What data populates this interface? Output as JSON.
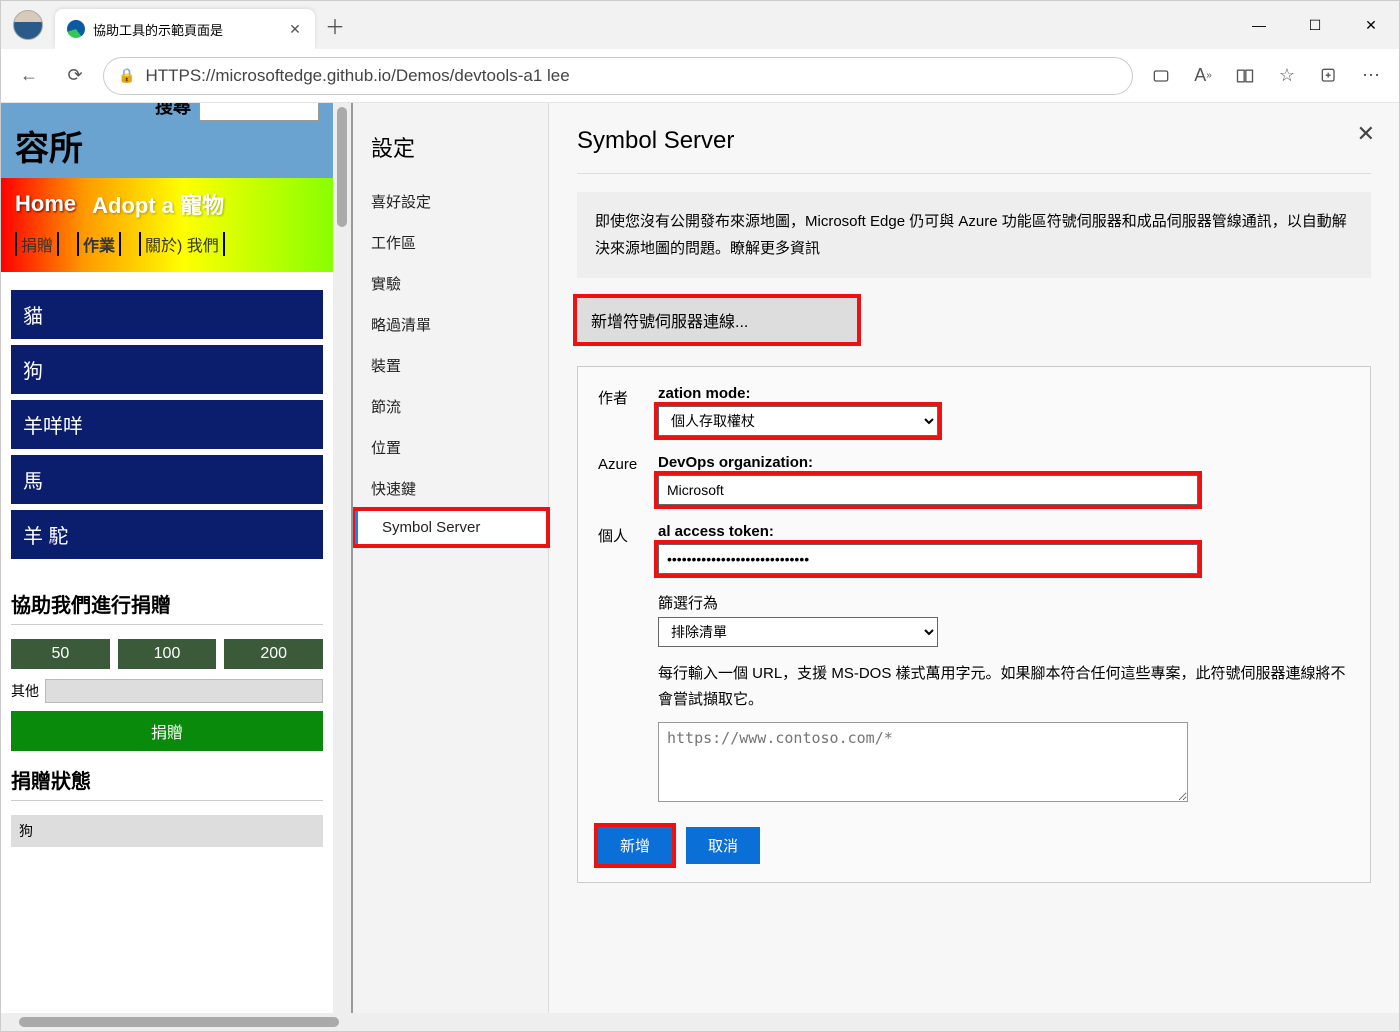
{
  "browser": {
    "tab_title": "協助工具的示範頁面是",
    "url": "HTTPS://microsoftedge.github.io/Demos/devtools-a1 lee"
  },
  "site": {
    "title": "容所",
    "search_label": "搜尋",
    "nav": {
      "home": "Home",
      "adopt": "Adopt a 寵物",
      "donate": "捐贈",
      "jobs": "作業",
      "about": "關於) 我們"
    },
    "animals": [
      "貓",
      "狗",
      "羊咩咩",
      "馬",
      "羊 駝"
    ],
    "donate": {
      "title": "協助我們進行捐贈",
      "amounts": [
        "50",
        "100",
        "200"
      ],
      "other_label": "其他",
      "button": "捐贈"
    },
    "status": {
      "title": "捐贈狀態",
      "value": "狗"
    }
  },
  "settings": {
    "title": "設定",
    "items": [
      "喜好設定",
      "工作區",
      "實驗",
      "略過清單",
      "裝置",
      "節流",
      "位置",
      "快速鍵",
      "Symbol Server"
    ],
    "active_index": 8
  },
  "symbol_server": {
    "heading": "Symbol Server",
    "description": "即使您沒有公開發布來源地圖，Microsoft Edge 仍可與 Azure 功能區符號伺服器和成品伺服器管線通訊，以自動解決來源地圖的問題。瞭解更多資訊",
    "add_button": "新增符號伺服器連線...",
    "auth_label_left": "作者",
    "auth_label_right": "zation mode:",
    "auth_value": "個人存取權杖",
    "org_label_left": "Azure",
    "org_label_right": "DevOps organization:",
    "org_value": "Microsoft",
    "pat_label_left": "個人",
    "pat_label_right": "al access token:",
    "pat_value": "•••••••••••••••••••••••••••••",
    "filter_label": "篩選行為",
    "filter_value": "排除清單",
    "filter_desc": "每行輸入一個 URL，支援 MS-DOS 樣式萬用字元。如果腳本符合任何這些專案，此符號伺服器連線將不會嘗試擷取它。",
    "filter_placeholder": "https://www.contoso.com/*",
    "add": "新增",
    "cancel": "取消"
  }
}
